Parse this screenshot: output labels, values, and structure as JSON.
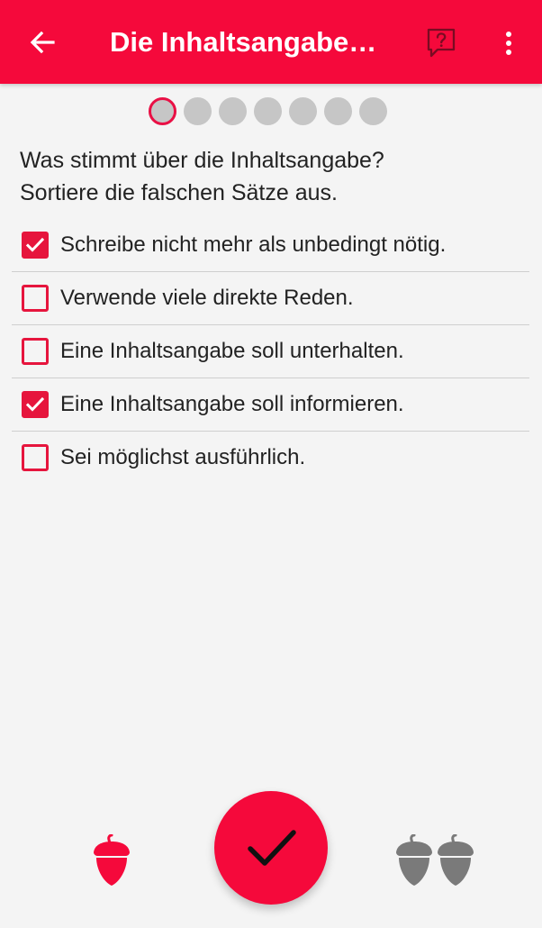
{
  "colors": {
    "primary": "#f5093b",
    "checkbox": "#e6153d",
    "dot_inactive": "#c6c6c6",
    "acorn_active": "#f5093b",
    "acorn_inactive": "#7a7a7a"
  },
  "topbar": {
    "back_icon": "arrow-left-icon",
    "title": "Die Inhaltsangabe…",
    "report_icon": "question-feedback-icon",
    "menu_icon": "more-vertical-icon"
  },
  "progress": {
    "current": 1,
    "total": 7
  },
  "question": {
    "line1": "Was stimmt über die Inhaltsangabe?",
    "line2": "Sortiere die falschen Sätze aus."
  },
  "options": [
    {
      "label": "Schreibe nicht mehr als unbedingt nötig.",
      "checked": true
    },
    {
      "label": "Verwende viele direkte Reden.",
      "checked": false
    },
    {
      "label": "Eine Inhaltsangabe soll unterhalten.",
      "checked": false
    },
    {
      "label": "Eine Inhaltsangabe soll informieren.",
      "checked": true
    },
    {
      "label": "Sei möglichst ausführlich.",
      "checked": false
    }
  ],
  "bottom": {
    "left_icon": "acorn-icon",
    "center_icon": "checkmark-icon",
    "right_icon": "double-acorn-icon"
  }
}
